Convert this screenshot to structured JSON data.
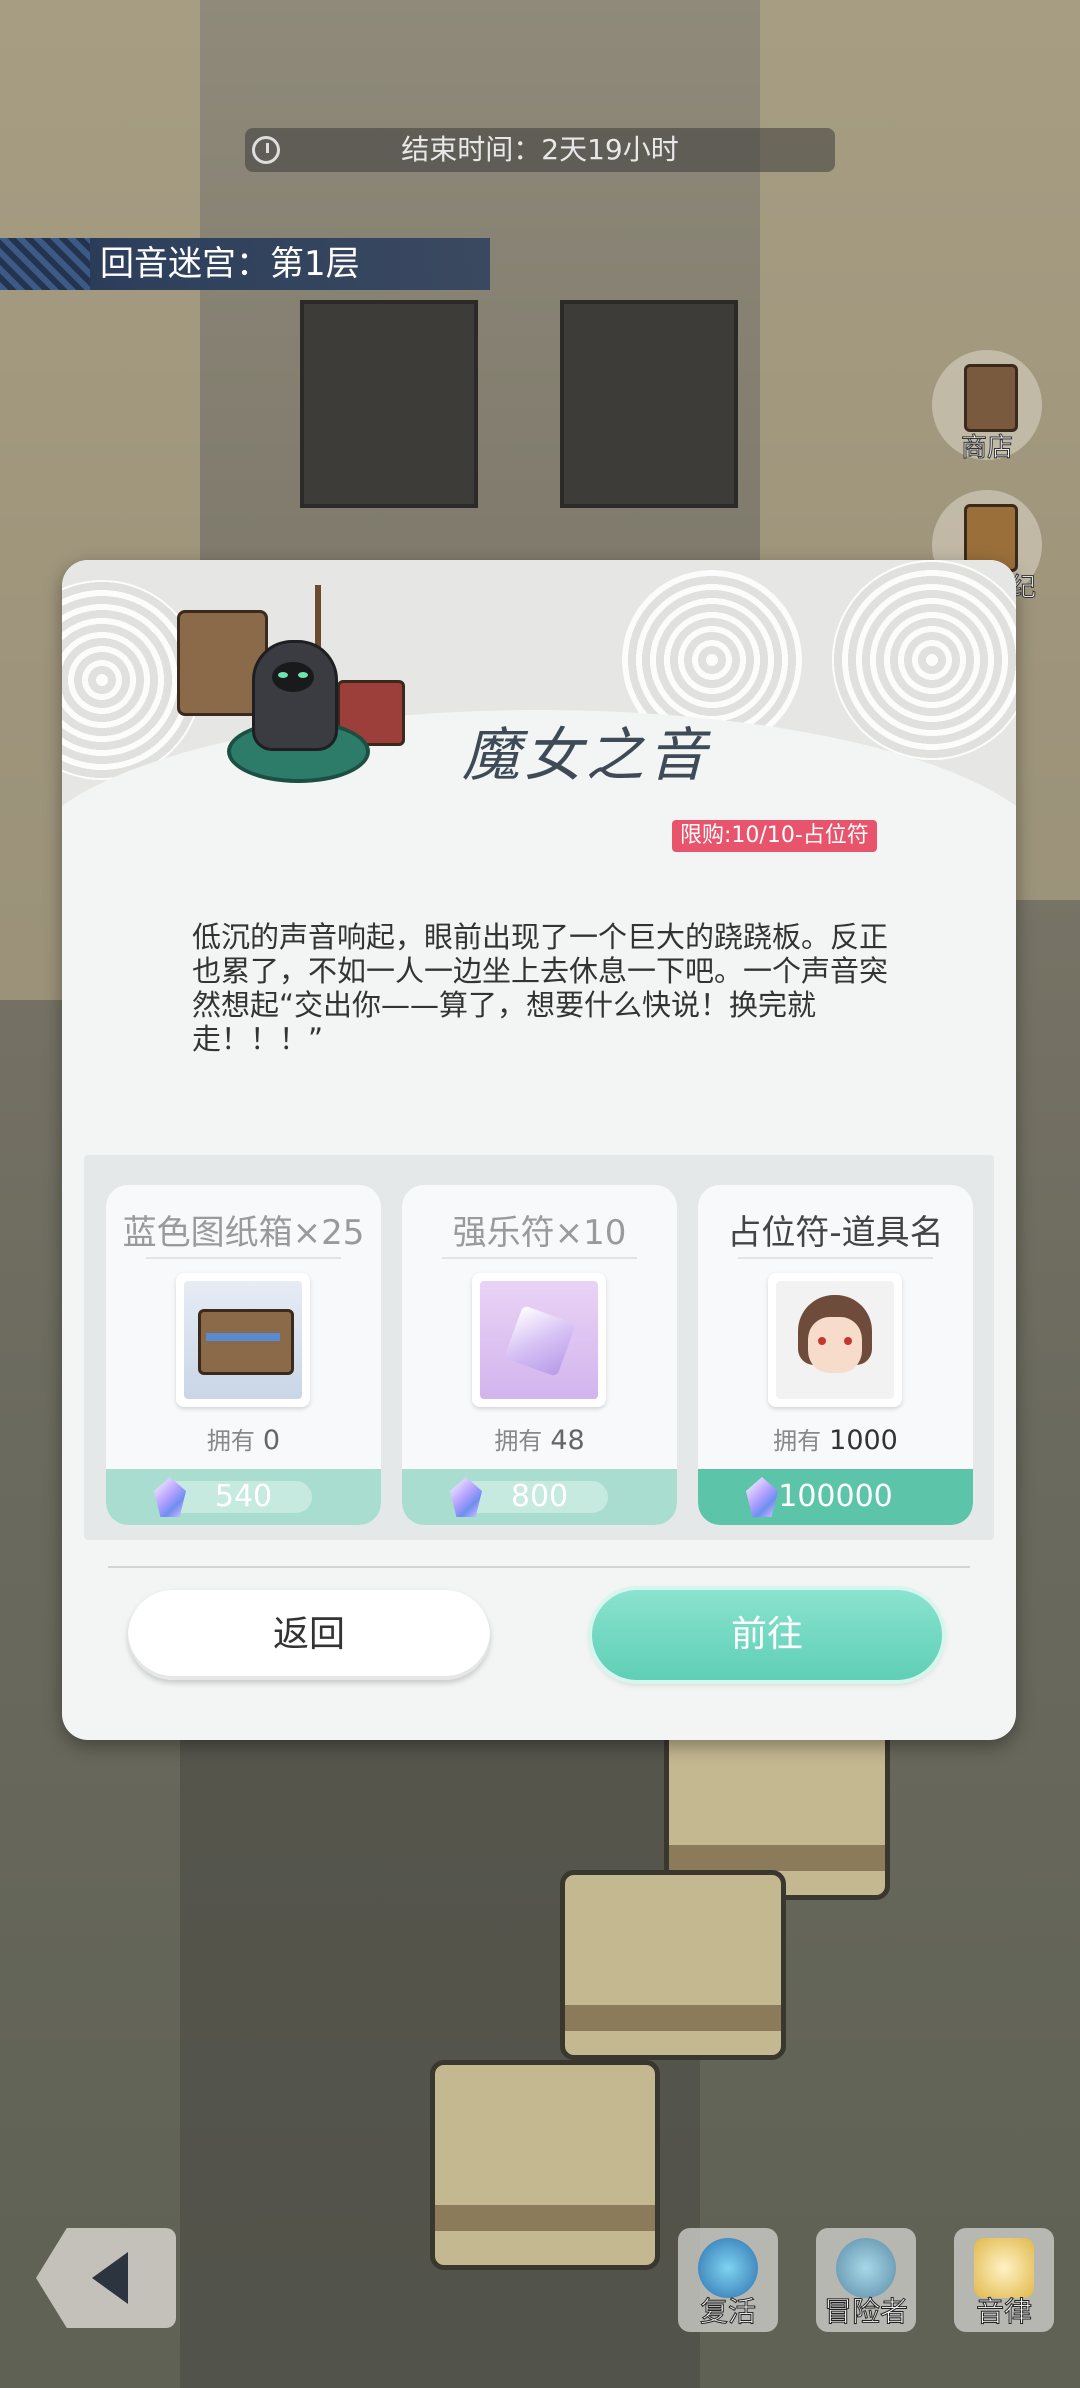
{
  "hud": {
    "end_time": "结束时间：2天19小时",
    "floor": "回音迷宫：第1层",
    "side_buttons": {
      "shop": "商店",
      "record": "纪"
    }
  },
  "dialog": {
    "title": "魔女之音",
    "story": "低沉的声音响起，眼前出现了一个巨大的跷跷板。反正也累了，不如一人一边坐上去休息一下吧。一个声音突然想起“交出你——算了，想要什么快说！换完就走！！！”",
    "items": [
      {
        "name": "蓝色图纸箱×25",
        "own_label": "拥有",
        "own_value": "0",
        "price": "540",
        "icon": "blueprint-chest-icon"
      },
      {
        "name": "强乐符×10",
        "own_label": "拥有",
        "own_value": "48",
        "price": "800",
        "icon": "music-crystal-icon"
      },
      {
        "name": "占位符-道具名",
        "own_label": "拥有",
        "own_value": "1000",
        "price": "100000",
        "icon": "character-portrait-icon",
        "limit": "限购:10/10-占位符"
      }
    ],
    "back_label": "返回",
    "go_label": "前往"
  },
  "bottom_bar": {
    "revive": "复活",
    "adventurer": "冒险者",
    "melody": "音律"
  },
  "colors": {
    "accent": "#5fcfb5",
    "limit": "#e8546b",
    "banner": "#24344f"
  }
}
